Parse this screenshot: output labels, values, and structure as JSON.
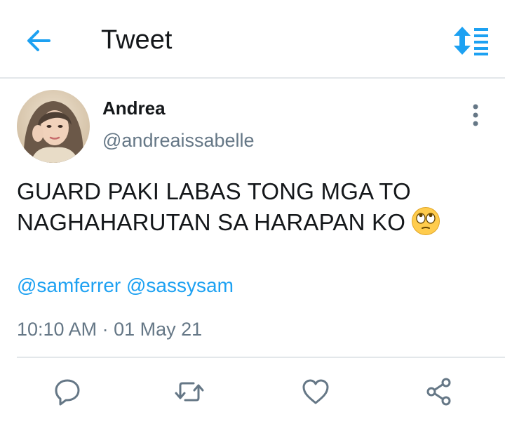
{
  "header": {
    "title": "Tweet",
    "back_icon": "arrow-left-icon",
    "sort_icon": "sort-list-icon",
    "accent_color": "#1da1f2"
  },
  "tweet": {
    "author": {
      "name": "Andrea",
      "handle": "@andreaissabelle",
      "avatar_icon": "profile-photo"
    },
    "text_line1": "GUARD PAKI LABAS TONG MGA TO",
    "text_line2": "NAGHAHARUTAN SA HARAPAN KO",
    "emoji": "face-with-rolling-eyes",
    "mentions": [
      "@samferrer",
      "@sassysam"
    ],
    "time": "10:10 AM",
    "separator": "·",
    "date": "01 May 21"
  },
  "actions": {
    "icons": [
      "reply-icon",
      "retweet-icon",
      "like-icon",
      "share-icon"
    ],
    "icon_color": "#657786"
  }
}
